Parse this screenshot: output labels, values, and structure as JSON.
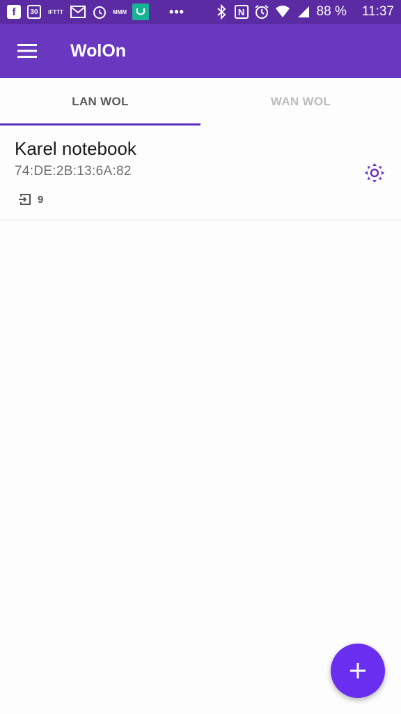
{
  "status_bar": {
    "notification_icons": [
      "facebook-icon",
      "calendar-icon",
      "ifttt-icon",
      "gmail-icon",
      "alarm-clock-app-icon",
      "mmm-icon",
      "mi-fit-icon"
    ],
    "calendar_day": "30",
    "ifttt_text": "IFTTT",
    "mmm_text": "MMM",
    "more_indicator": "•••",
    "battery": "88 %",
    "time": "11:37"
  },
  "app_bar": {
    "title": "WolOn",
    "menu_icon": "hamburger-menu-icon"
  },
  "tabs": [
    {
      "label": "LAN WOL",
      "active": true
    },
    {
      "label": "WAN WOL",
      "active": false
    }
  ],
  "devices": [
    {
      "name": "Karel notebook",
      "mac": "74:DE:2B:13:6A:82",
      "port": "9",
      "action_icon": "brightness-icon"
    }
  ],
  "fab": {
    "icon": "plus-icon"
  },
  "colors": {
    "status_bar": "#5b2ba3",
    "app_bar": "#6a38c0",
    "accent": "#6a2ef0",
    "tab_indicator": "#5a2ebf",
    "mi_fit": "#18b394"
  }
}
